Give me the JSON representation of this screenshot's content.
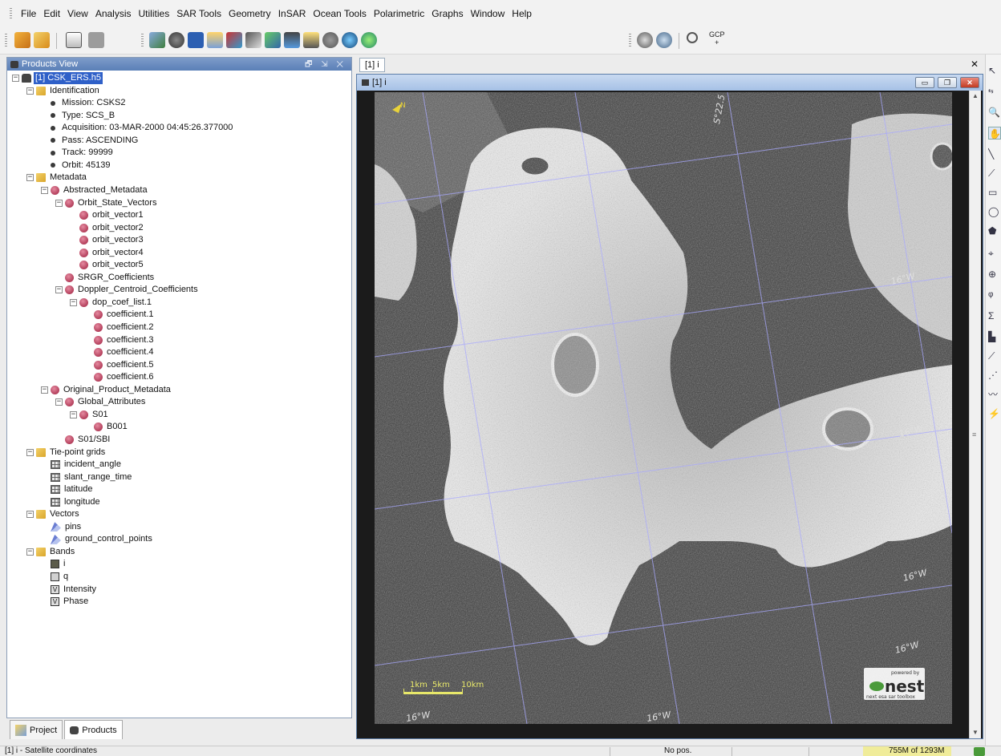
{
  "menu": [
    "File",
    "Edit",
    "View",
    "Analysis",
    "Utilities",
    "SAR Tools",
    "Geometry",
    "InSAR",
    "Ocean Tools",
    "Polarimetric",
    "Graphs",
    "Window",
    "Help"
  ],
  "toolbar": {
    "gcp_label": "GCP"
  },
  "products_panel": {
    "title": "Products View",
    "controls": "🗗 ⇲ ✕",
    "tree": [
      {
        "label": "[1] CSK_ERS.h5",
        "icon": "product",
        "selected": true
      },
      {
        "label": "Identification",
        "icon": "folder"
      },
      {
        "label": "Mission: CSKS2",
        "icon": "dot"
      },
      {
        "label": "Type: SCS_B",
        "icon": "dot"
      },
      {
        "label": "Acquisition: 03-MAR-2000 04:45:26.377000",
        "icon": "dot"
      },
      {
        "label": "Pass: ASCENDING",
        "icon": "dot"
      },
      {
        "label": "Track: 99999",
        "icon": "dot"
      },
      {
        "label": "Orbit: 45139",
        "icon": "dot"
      },
      {
        "label": "Metadata",
        "icon": "folder"
      },
      {
        "label": "Abstracted_Metadata",
        "icon": "info"
      },
      {
        "label": "Orbit_State_Vectors",
        "icon": "info"
      },
      {
        "label": "orbit_vector1",
        "icon": "info"
      },
      {
        "label": "orbit_vector2",
        "icon": "info"
      },
      {
        "label": "orbit_vector3",
        "icon": "info"
      },
      {
        "label": "orbit_vector4",
        "icon": "info"
      },
      {
        "label": "orbit_vector5",
        "icon": "info"
      },
      {
        "label": "SRGR_Coefficients",
        "icon": "info"
      },
      {
        "label": "Doppler_Centroid_Coefficients",
        "icon": "info"
      },
      {
        "label": "dop_coef_list.1",
        "icon": "info"
      },
      {
        "label": "coefficient.1",
        "icon": "info"
      },
      {
        "label": "coefficient.2",
        "icon": "info"
      },
      {
        "label": "coefficient.3",
        "icon": "info"
      },
      {
        "label": "coefficient.4",
        "icon": "info"
      },
      {
        "label": "coefficient.5",
        "icon": "info"
      },
      {
        "label": "coefficient.6",
        "icon": "info"
      },
      {
        "label": "Original_Product_Metadata",
        "icon": "info"
      },
      {
        "label": "Global_Attributes",
        "icon": "info"
      },
      {
        "label": "S01",
        "icon": "info"
      },
      {
        "label": "B001",
        "icon": "info"
      },
      {
        "label": "S01/SBI",
        "icon": "info"
      },
      {
        "label": "Tie-point grids",
        "icon": "folder"
      },
      {
        "label": "incident_angle",
        "icon": "grid"
      },
      {
        "label": "slant_range_time",
        "icon": "grid"
      },
      {
        "label": "latitude",
        "icon": "grid"
      },
      {
        "label": "longitude",
        "icon": "grid"
      },
      {
        "label": "Vectors",
        "icon": "folder"
      },
      {
        "label": "pins",
        "icon": "vector"
      },
      {
        "label": "ground_control_points",
        "icon": "vector"
      },
      {
        "label": "Bands",
        "icon": "folder"
      },
      {
        "label": "i",
        "icon": "band-dark"
      },
      {
        "label": "q",
        "icon": "band-light"
      },
      {
        "label": "Intensity",
        "icon": "vband"
      },
      {
        "label": "Phase",
        "icon": "vband"
      }
    ]
  },
  "bottom_tabs": [
    "Project",
    "Products"
  ],
  "image_window": {
    "tab_label": "[1] i",
    "title": "[1] i",
    "scale_labels": [
      "1km",
      "5km",
      "10km"
    ],
    "grid_labels": [
      "S°22.5",
      "16°W",
      "16°W",
      "16°W",
      "16°W",
      "16°W",
      "16°W"
    ],
    "north_label": "N",
    "logo": {
      "top": "powered by",
      "name": "nest",
      "tagline": "next esa sar toolbox"
    }
  },
  "status": {
    "left": "[1] i - Satellite coordinates",
    "position": "No pos.",
    "memory": "755M of 1293M"
  }
}
